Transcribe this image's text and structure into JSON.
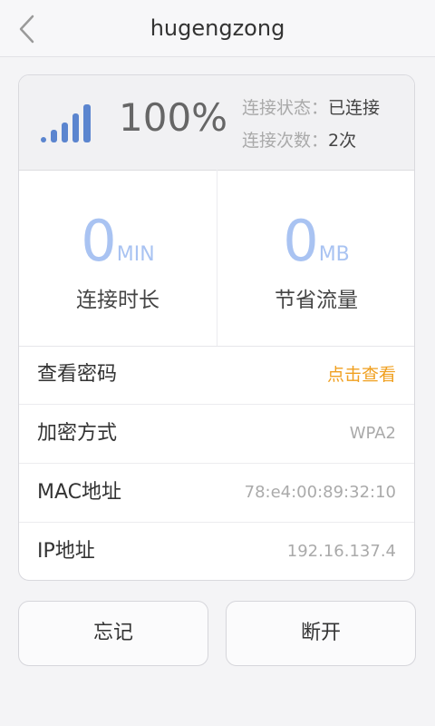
{
  "header": {
    "title": "hugengzong"
  },
  "status": {
    "signal_percent": "100%",
    "connection_state_label": "连接状态：",
    "connection_state_value": "已连接",
    "connection_count_label": "连接次数：",
    "connection_count_value": "2次"
  },
  "stats": {
    "duration_value": "0",
    "duration_unit": "MIN",
    "duration_label": "连接时长",
    "saved_value": "0",
    "saved_unit": "MB",
    "saved_label": "节省流量"
  },
  "details": {
    "password_label": "查看密码",
    "password_action": "点击查看",
    "encryption_label": "加密方式",
    "encryption_value": "WPA2",
    "mac_label": "MAC地址",
    "mac_value": "78:e4:00:89:32:10",
    "ip_label": "IP地址",
    "ip_value": "192.16.137.4"
  },
  "actions": {
    "forget_label": "忘记",
    "disconnect_label": "断开"
  },
  "colors": {
    "accent_blue": "#a9c3f2",
    "signal_blue": "#5b85cf",
    "link_orange": "#f0a020"
  },
  "icons": {
    "back": "chevron-left-icon",
    "signal": "signal-strength-icon"
  }
}
